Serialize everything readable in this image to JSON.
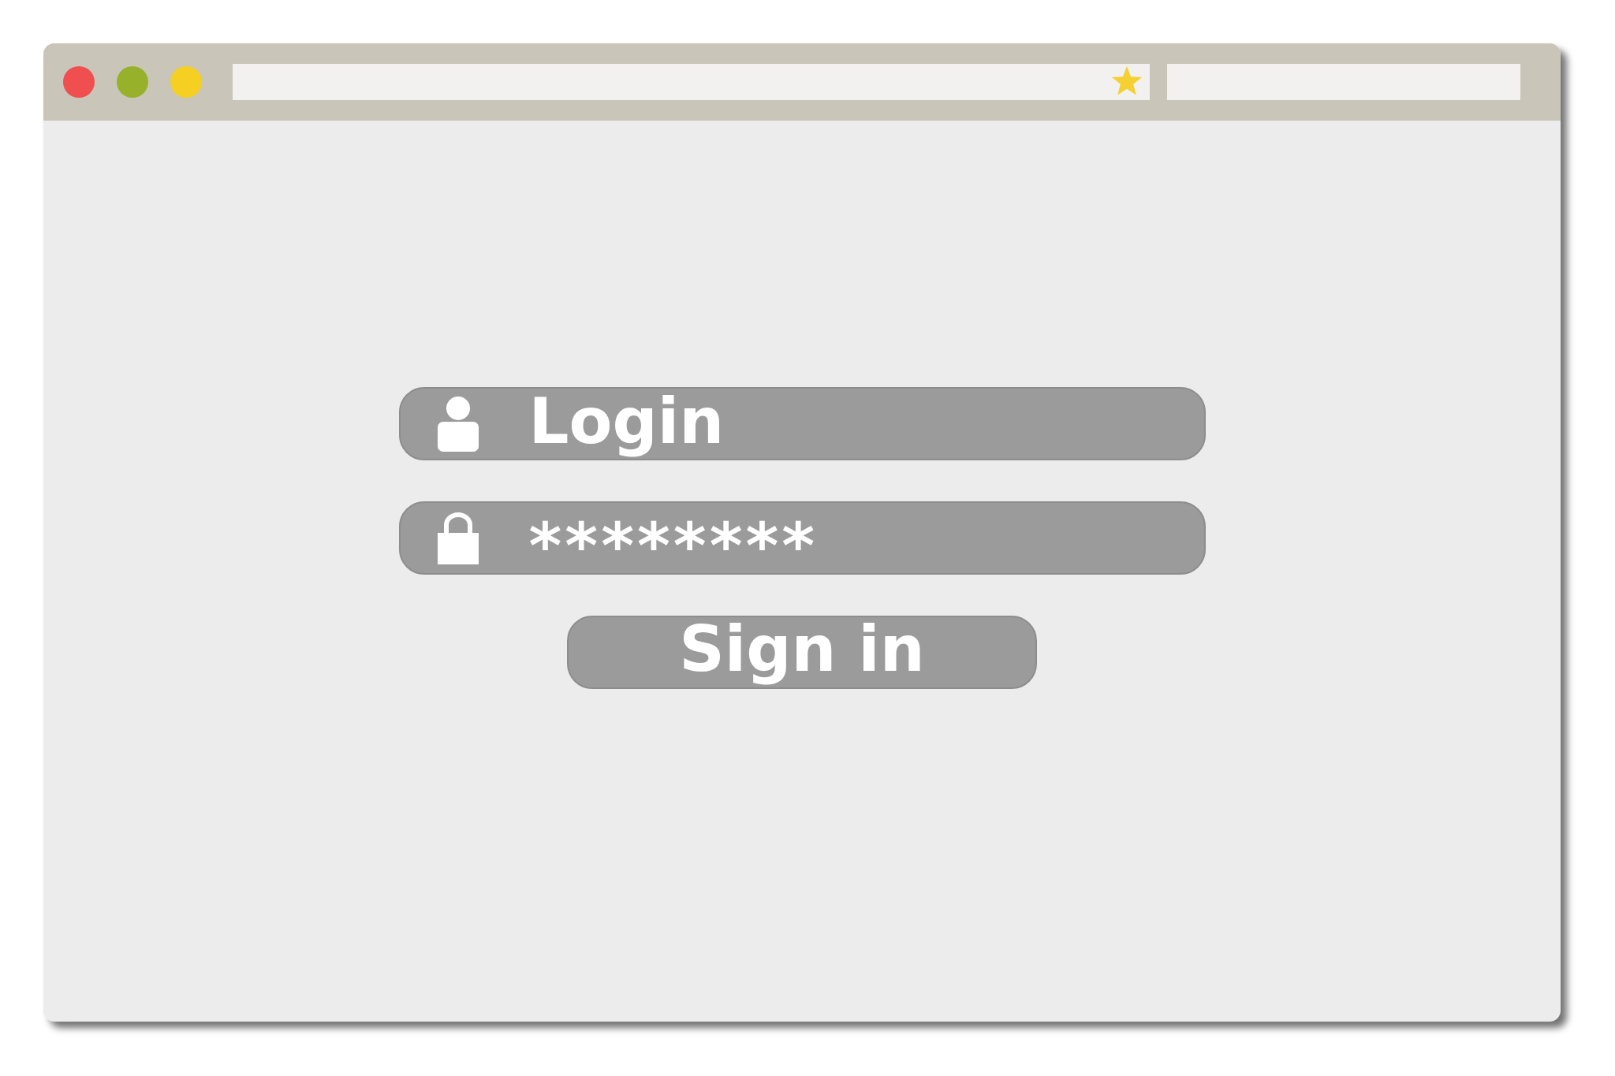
{
  "login_form": {
    "username_field": {
      "value": "Login"
    },
    "password_field": {
      "value": "********"
    },
    "sign_in_button": {
      "label": "Sign in"
    }
  }
}
